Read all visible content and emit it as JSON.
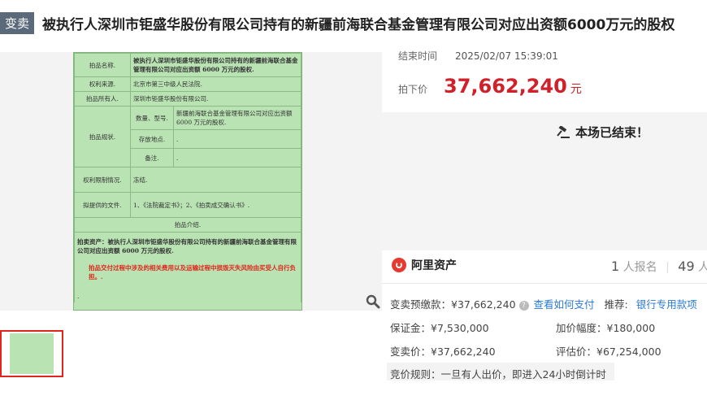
{
  "header": {
    "tag": "变卖",
    "title": "被执行人深圳市钜盛华股份有限公司持有的新疆前海联合基金管理有限公司对应出资额6000万元的股权"
  },
  "document": {
    "rows": [
      {
        "label": "拍品名称.",
        "value": "被执行人深圳市钜盛华股份有限公司持有的新疆前海联合基金管理有限公司对应出资额 6000 万元的股权."
      },
      {
        "label": "权利来源.",
        "value": "北京市第三中级人民法院."
      },
      {
        "label": "拍品所有人.",
        "value": "深圳市钜盛华股份有限公司."
      },
      {
        "label": "拍品规状.",
        "sub": [
          {
            "label": "数量、型号.",
            "value": "新疆前海联合基金管理有限公司对应出资额 6000 万元的股权."
          },
          {
            "label": "存放地点.",
            "value": "."
          },
          {
            "label": "备注.",
            "value": "."
          }
        ]
      },
      {
        "label": "权利限制情况.",
        "value": "冻结."
      },
      {
        "label": "拟提供的文件.",
        "value": "1、《法院裁定书》；2、《拍卖成交确认书》."
      }
    ],
    "intro_heading": "拍品介绍.",
    "intro_text": "拍卖资产：被执行人深圳市钜盛华股份有限公司持有的新疆前海联合基金管理有限公司对应出资额 6000 万元的股权.",
    "warning": "拍品交付过程中涉及的相关费用以及运输过程中损毁灭失风险由买受人自行负担。.",
    "tail": "."
  },
  "end_time": {
    "label": "结束时间",
    "value": "2025/02/07 15:39:01"
  },
  "price": {
    "label": "拍下价",
    "value": "37,662,240",
    "unit": "元"
  },
  "status": {
    "text": "本场已结束！"
  },
  "platform": {
    "name": "阿里资产"
  },
  "counts": {
    "registered": "1",
    "registered_label": "人报名",
    "watchers": "49",
    "watchers_label": "人设"
  },
  "details": {
    "deposit_prepay_label": "变卖预缴款：",
    "deposit_prepay_value": "¥37,662,240",
    "how_to_pay": "查看如何支付",
    "recommend_label": "推荐:",
    "recommend_link": "银行专用款项",
    "bond": "保证金：¥7,530,000",
    "increment": "加价幅度：¥180,000",
    "sell_price": "变卖价：¥37,662,240",
    "appraisal": "评估价：¥67,254,000",
    "rule": "竞价规则：一旦有人出价，即进入24小时倒计时"
  },
  "colors": {
    "accent_red": "#d0202a",
    "link_blue": "#2a7ad6",
    "doc_green": "#b9e3b3"
  }
}
